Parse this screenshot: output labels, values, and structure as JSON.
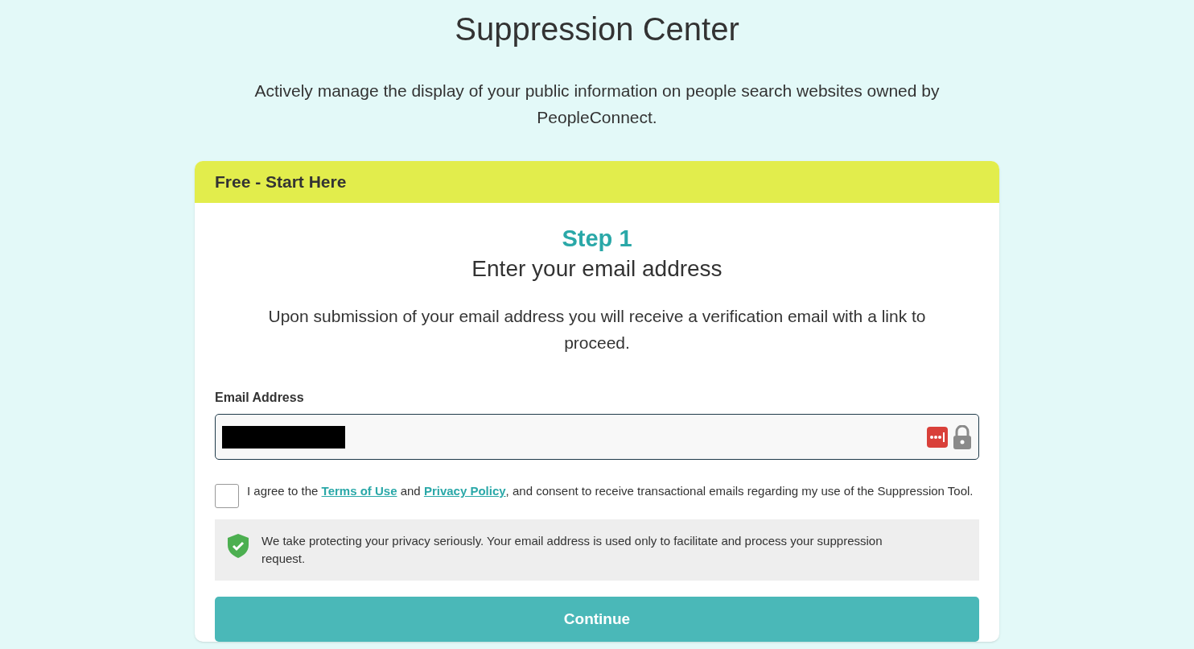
{
  "page": {
    "title": "Suppression Center",
    "subtitle": "Actively manage the display of your public information on people search websites owned by PeopleConnect."
  },
  "card": {
    "header": "Free - Start Here",
    "step": "Step 1",
    "heading": "Enter your email address",
    "description": "Upon submission of your email address you will receive a verification email with a link to proceed.",
    "email_field": {
      "label": "Email Address"
    },
    "consent": {
      "checked": false,
      "before": "I agree to the",
      "terms_link": "Terms of Use",
      "middle": "and",
      "privacy_link": "Privacy Policy",
      "after": ", and consent to receive transactional emails regarding my use of the Suppression Tool."
    },
    "privacy_note": "We take protecting your privacy seriously. Your email address is used only to facilitate and process your suppression request.",
    "button": "Continue"
  }
}
